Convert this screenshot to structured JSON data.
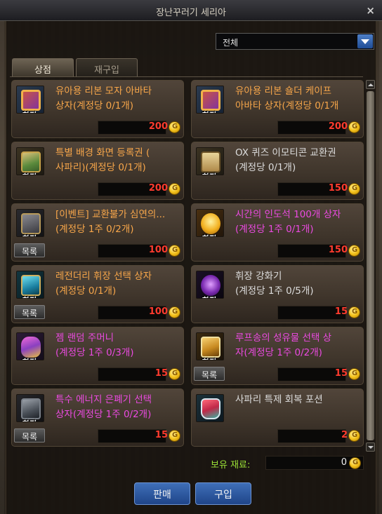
{
  "window": {
    "title": "장난꾸러기 세리아",
    "close": "×"
  },
  "filter": {
    "value": "전체"
  },
  "tabs": [
    {
      "label": "상점",
      "active": true
    },
    {
      "label": "재구입",
      "active": false
    }
  ],
  "items": [
    {
      "name": "유아용 리본 모자 아바타\n상자(계정당 0/1개)",
      "color": "orange",
      "price": "200",
      "badge": "한정",
      "icon": "ribbon-hat-box-icon",
      "list_button": ""
    },
    {
      "name": "유아용 리본 숄더 케이프\n아바타 상자(계정당 0/1개",
      "color": "orange",
      "price": "200",
      "badge": "한정",
      "icon": "ribbon-cape-box-icon",
      "list_button": ""
    },
    {
      "name": "특별 배경 화면 등록권 (\n사파리)(계정당 0/1개)",
      "color": "orange",
      "price": "200",
      "badge": "한정",
      "icon": "wallpaper-ticket-icon",
      "list_button": ""
    },
    {
      "name": "OX 퀴즈 이모티콘 교환권\n(계정당 0/1개)",
      "color": "gray",
      "price": "150",
      "badge": "한정",
      "icon": "emoticon-ticket-icon",
      "list_button": ""
    },
    {
      "name": "[이벤트] 교환불가 심연의...\n(계정당 1주 0/2개)",
      "color": "orange",
      "price": "100",
      "badge": "한정",
      "icon": "abyss-chest-icon",
      "list_button": "목록"
    },
    {
      "name": "시간의 인도석 100개 상자\n(계정당 1주 0/1개)",
      "color": "magenta",
      "price": "150",
      "badge": "한정",
      "icon": "time-stone-box-icon",
      "list_button": ""
    },
    {
      "name": "레전더리 휘장 선택 상자\n(계정당 0/1개)",
      "color": "orange",
      "price": "100",
      "badge": "한정",
      "icon": "legendary-emblem-box-icon",
      "list_button": "목록"
    },
    {
      "name": "휘장 강화기\n(계정당 1주 0/5개)",
      "color": "gray",
      "price": "15",
      "badge": "한정",
      "icon": "emblem-enhancer-icon",
      "list_button": ""
    },
    {
      "name": "젬 랜덤 주머니\n(계정당 1주 0/3개)",
      "color": "magenta",
      "price": "15",
      "badge": "한정",
      "icon": "gem-pouch-icon",
      "list_button": ""
    },
    {
      "name": "루프송의 성유물 선택 상\n자(계정당 1주 0/2개)",
      "color": "magenta",
      "price": "15",
      "badge": "한정",
      "icon": "relic-select-box-icon",
      "list_button": "목록"
    },
    {
      "name": "특수 에너지 은폐기 선택\n상자(계정당 1주 0/2개)",
      "color": "magenta",
      "price": "15",
      "badge": "한정",
      "icon": "energy-concealer-box-icon",
      "list_button": "목록"
    },
    {
      "name": "사파리 특제 회복 포션",
      "color": "gray",
      "price": "2",
      "badge": "",
      "icon": "recovery-potion-icon",
      "list_button": ""
    }
  ],
  "material": {
    "label": "보유 재료:",
    "value": "0"
  },
  "actions": {
    "sell": "판매",
    "buy": "구입"
  }
}
